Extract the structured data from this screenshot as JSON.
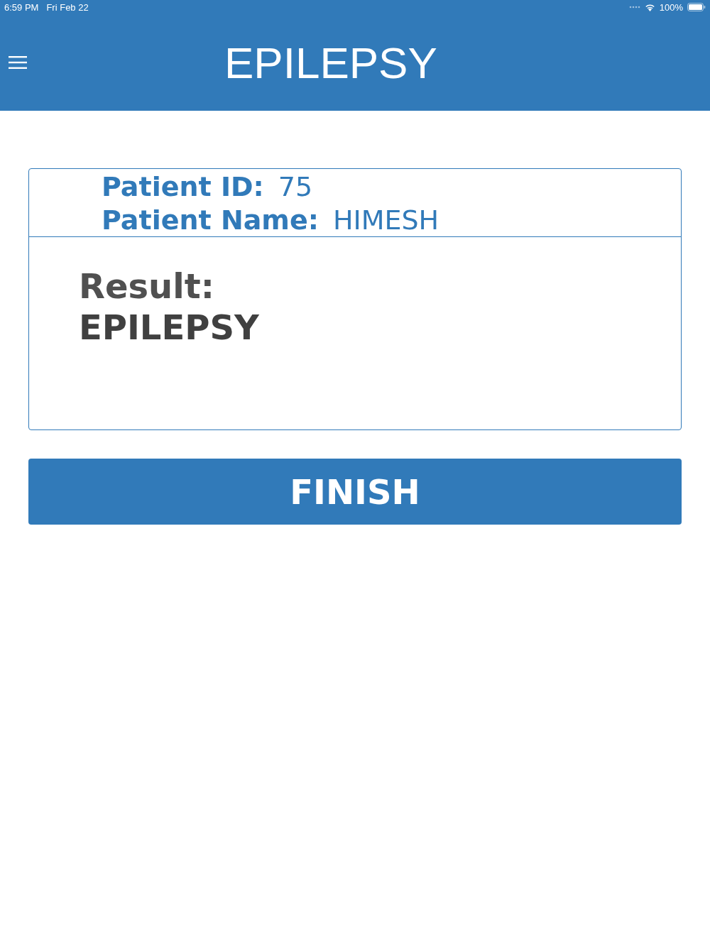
{
  "status_bar": {
    "time": "6:59 PM",
    "date": "Fri Feb 22",
    "battery": "100%"
  },
  "header": {
    "title": "EPILEPSY"
  },
  "patient": {
    "id_label": "Patient ID:",
    "id_value": "75",
    "name_label": "Patient Name:",
    "name_value": "HIMESH"
  },
  "result": {
    "label": "Result:",
    "value": "EPILEPSY"
  },
  "finish_button": {
    "label": "FINISH"
  }
}
